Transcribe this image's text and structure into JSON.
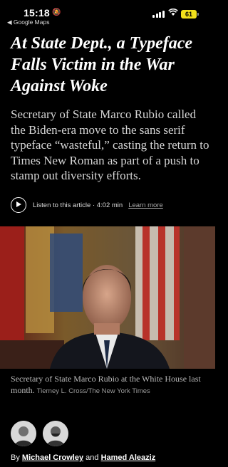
{
  "status_bar": {
    "time": "15:18",
    "back_label": "◀ Google Maps",
    "battery": "61"
  },
  "article": {
    "headline": "At State Dept., a Typeface Falls Victim in the War Against Woke",
    "summary": "Secretary of State Marco Rubio called the Biden-era move to the sans serif typeface “wasteful,” casting the return to Times New Roman as part of a push to stamp out diversity efforts.",
    "listen_label": "Listen to this article · 4:02 min",
    "learn_more": "Learn more",
    "caption": "Secretary of State Marco Rubio at the White House last month.",
    "credit": "Tierney L. Cross/The New York Times",
    "byline_prefix": "By",
    "author_1": "Michael Crowley",
    "byline_joiner": "and",
    "author_2": "Hamed Aleaziz"
  },
  "colors": {
    "background": "#000000",
    "battery": "#f2e01b"
  }
}
